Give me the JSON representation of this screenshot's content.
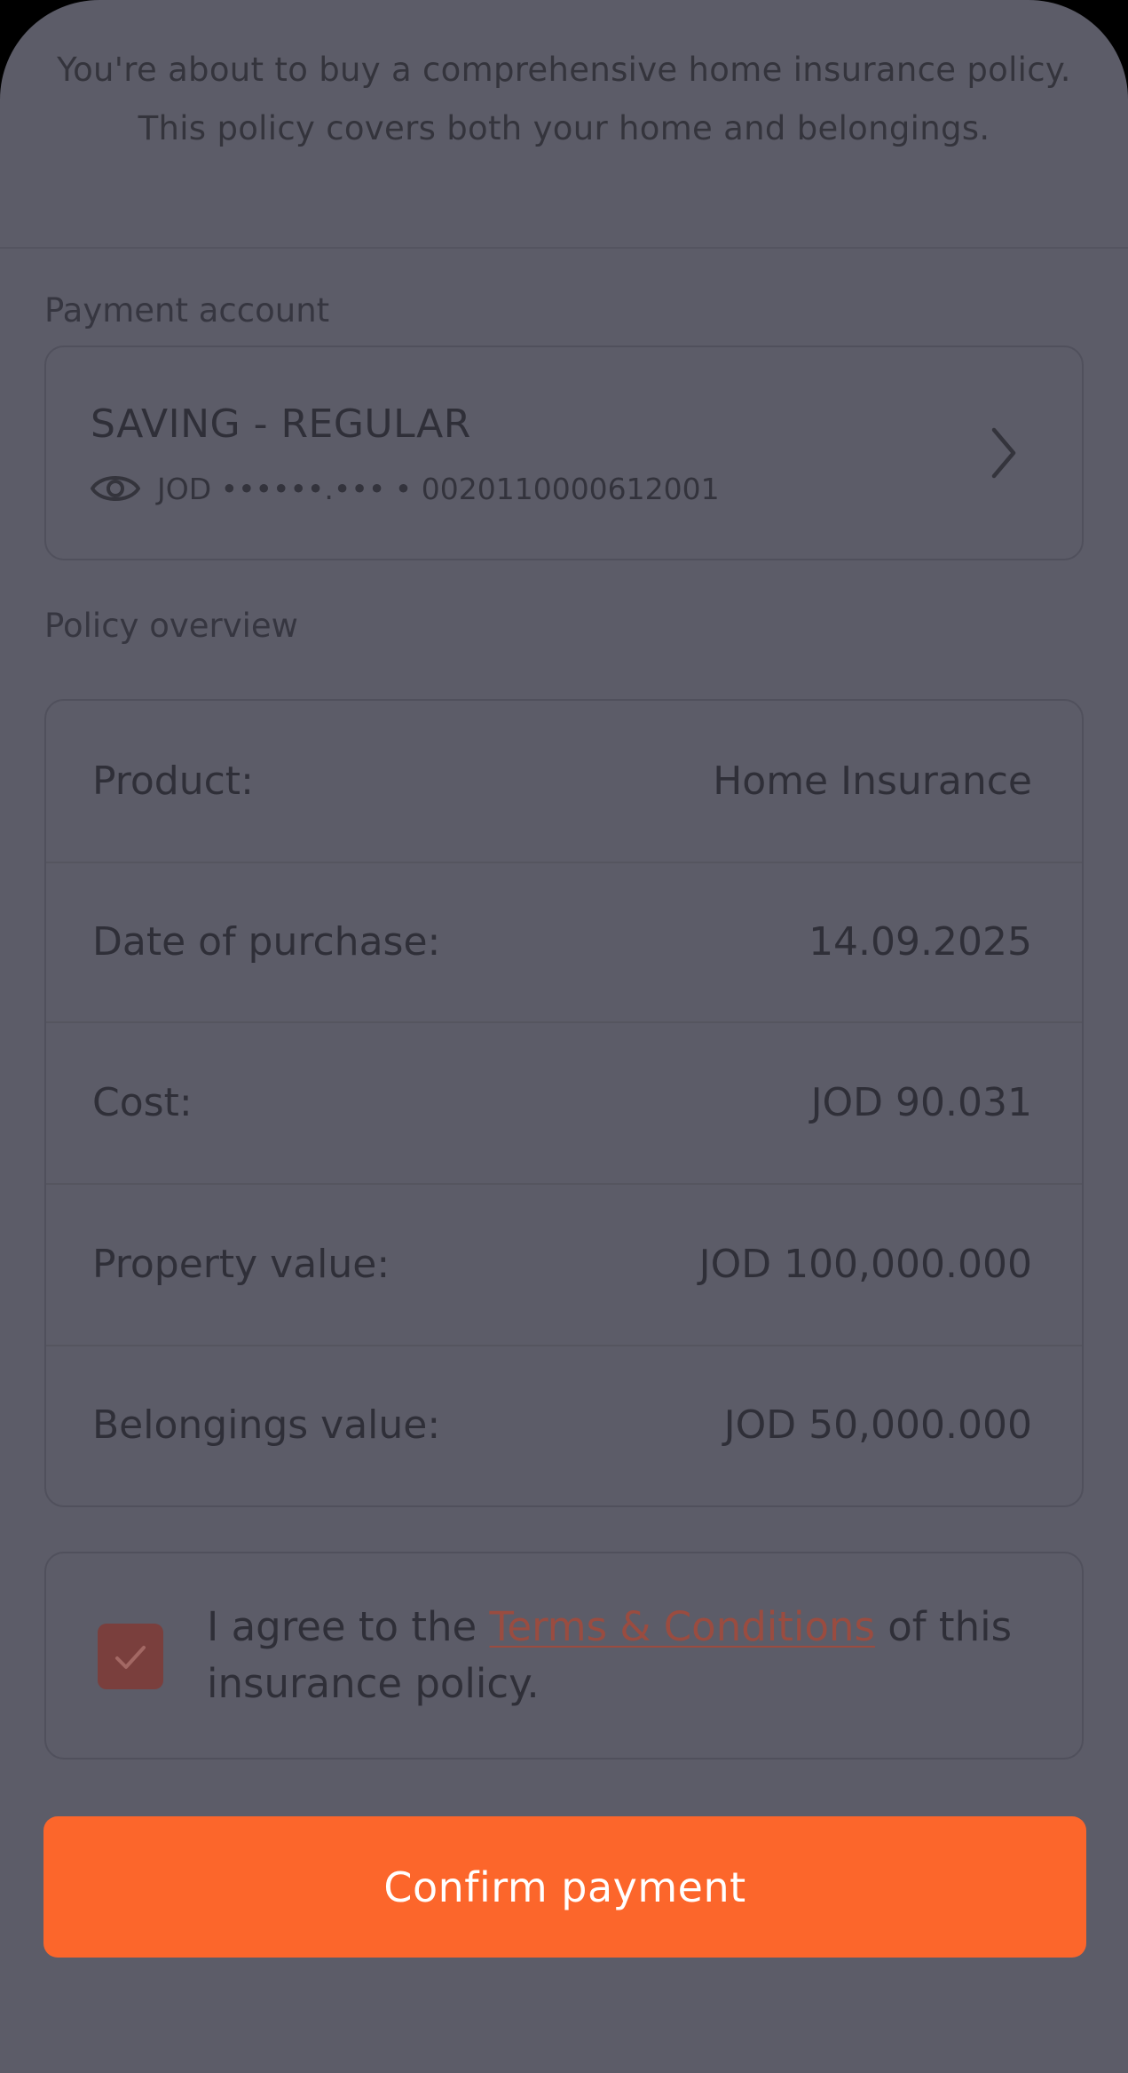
{
  "intro": {
    "text": "You're about to buy a comprehensive home insurance policy. This policy covers both your home and belongings."
  },
  "payment_account": {
    "section_label": "Payment account",
    "account_name": "SAVING - REGULAR",
    "masked_balance": "JOD ••••••.••• • 0020110000612001",
    "icons": {
      "visibility": "eye-icon",
      "navigate": "chevron-right-icon"
    }
  },
  "policy_overview": {
    "section_label": "Policy overview",
    "rows": [
      {
        "label": "Product:",
        "value": "Home Insurance"
      },
      {
        "label": "Date of purchase:",
        "value": "14.09.2025"
      },
      {
        "label": "Cost:",
        "value": "JOD 90.031"
      },
      {
        "label": "Property value:",
        "value": "JOD 100,000.000"
      },
      {
        "label": "Belongings value:",
        "value": "JOD 50,000.000"
      }
    ]
  },
  "terms": {
    "checked": true,
    "prefix": "I agree to the ",
    "link_text": "Terms & Conditions",
    "suffix": " of this insurance policy.",
    "icon": "checkmark-icon"
  },
  "actions": {
    "confirm_label": "Confirm payment"
  },
  "colors": {
    "accent": "#fc662b",
    "overlay_background": "#5c5c68",
    "checkbox_fill": "#7a3f3d",
    "link": "#9a4c40"
  }
}
